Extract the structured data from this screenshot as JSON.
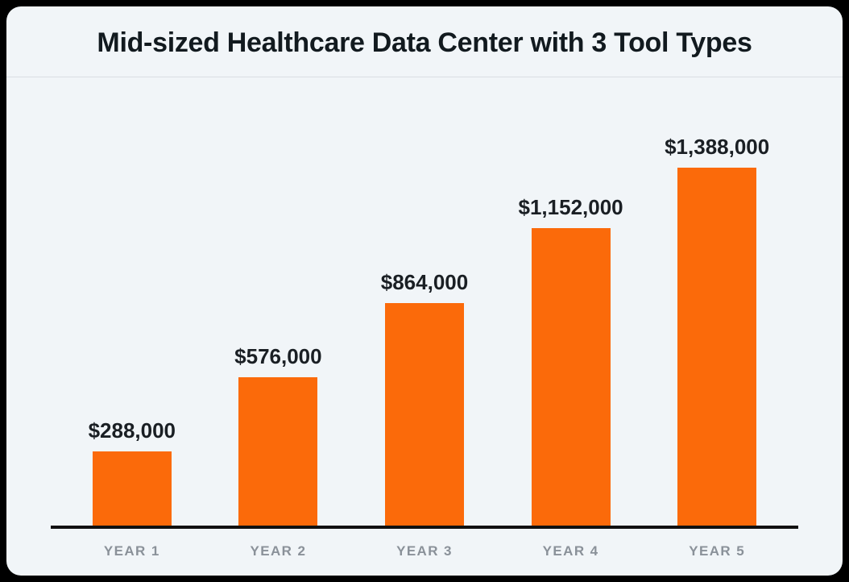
{
  "chart_data": {
    "type": "bar",
    "title": "Mid-sized Healthcare Data Center with 3 Tool Types",
    "categories": [
      "YEAR 1",
      "YEAR 2",
      "YEAR 3",
      "YEAR 4",
      "YEAR 5"
    ],
    "values": [
      288000,
      576000,
      864000,
      1152000,
      1388000
    ],
    "value_labels": [
      "$288,000",
      "$576,000",
      "$864,000",
      "$1,152,000",
      "$1,388,000"
    ],
    "xlabel": "",
    "ylabel": "",
    "ylim": [
      0,
      1500000
    ],
    "bar_color": "#FB6A0A",
    "background": "#F1F5F8"
  }
}
